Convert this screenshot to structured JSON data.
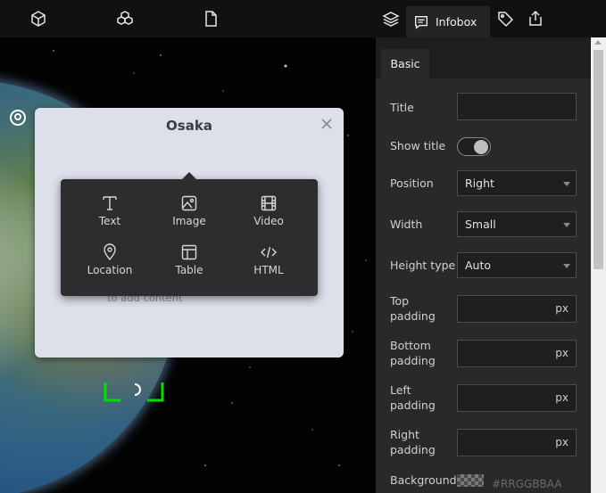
{
  "toolbar": {
    "left_icons": [
      "box-icon",
      "cubes-icon",
      "file-icon"
    ],
    "right_icons": [
      "layers-icon",
      "tag-icon",
      "export-icon"
    ],
    "active_tab": {
      "label": "Infobox",
      "icon": "message-square-icon"
    }
  },
  "popup": {
    "title": "Osaka",
    "hint": "to add content",
    "blocks": [
      {
        "label": "Text",
        "icon": "text-icon"
      },
      {
        "label": "Image",
        "icon": "image-icon"
      },
      {
        "label": "Video",
        "icon": "video-icon"
      },
      {
        "label": "Location",
        "icon": "location-pin-icon"
      },
      {
        "label": "Table",
        "icon": "table-icon"
      },
      {
        "label": "HTML",
        "icon": "code-icon"
      }
    ]
  },
  "panel": {
    "tab": "Basic",
    "title_label": "Title",
    "title_value": "",
    "show_title_label": "Show title",
    "show_title_on": true,
    "position_label": "Position",
    "position_value": "Right",
    "width_label": "Width",
    "width_value": "Small",
    "height_type_label": "Height type",
    "height_type_value": "Auto",
    "top_padding_label_1": "Top",
    "top_padding_label_2": "padding",
    "bottom_padding_label_1": "Bottom",
    "bottom_padding_label_2": "padding",
    "left_padding_label_1": "Left",
    "left_padding_label_2": "padding",
    "right_padding_label_1": "Right",
    "right_padding_label_2": "padding",
    "unit": "px",
    "background_label": "Background",
    "background_value": "#RRGGBBAA"
  },
  "colors": {
    "topbar": "#111111",
    "panel": "#29292b",
    "popup": "#dde0ea",
    "menu": "#2d2d30",
    "selection": "#00e000"
  }
}
